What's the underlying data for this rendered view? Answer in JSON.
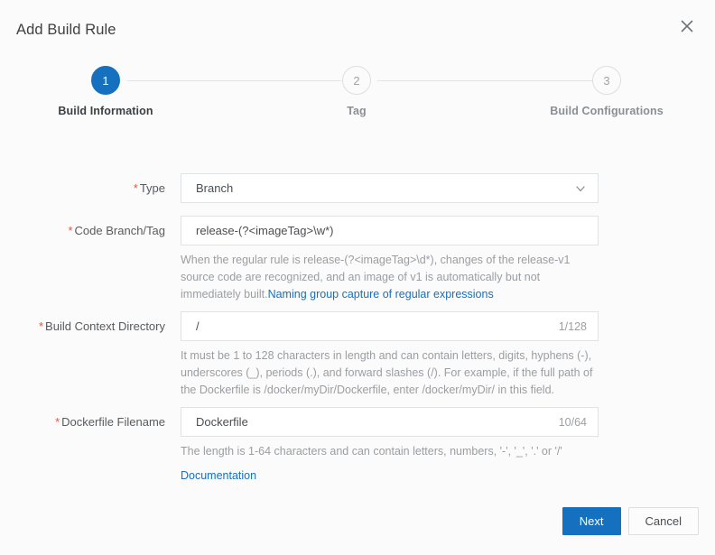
{
  "dialog": {
    "title": "Add Build Rule",
    "close_icon": "close-icon"
  },
  "stepper": {
    "steps": [
      {
        "number": "1",
        "label": "Build Information",
        "state": "active"
      },
      {
        "number": "2",
        "label": "Tag",
        "state": "inactive"
      },
      {
        "number": "3",
        "label": "Build Configurations",
        "state": "inactive"
      }
    ]
  },
  "form": {
    "type": {
      "label": "Type",
      "required_marker": "*",
      "value": "Branch",
      "chevron_icon": "chevron-down-icon"
    },
    "code_branch_tag": {
      "label": "Code Branch/Tag",
      "required_marker": "*",
      "value": "release-(?<imageTag>\\w*)",
      "hint_text": "When the regular rule is release-(?<imageTag>\\d*), changes of the release-v1 source code are recognized, and an image of v1 is automatically but not immediately built.",
      "hint_link": "Naming group capture of regular expressions"
    },
    "build_context_directory": {
      "label": "Build Context Directory",
      "required_marker": "*",
      "value": "/",
      "counter": "1/128",
      "hint_text": "It must be 1 to 128 characters in length and can contain letters, digits, hyphens (-), underscores (_), periods (.), and forward slashes (/). For example, if the full path of the Dockerfile is /docker/myDir/Dockerfile, enter /docker/myDir/ in this field."
    },
    "dockerfile_filename": {
      "label": "Dockerfile Filename",
      "required_marker": "*",
      "value": "Dockerfile",
      "counter": "10/64",
      "hint_text": "The length is 1-64 characters and can contain letters, numbers, '-', '_', '.' or '/'",
      "doc_link": "Documentation"
    }
  },
  "footer": {
    "next_label": "Next",
    "cancel_label": "Cancel"
  },
  "colors": {
    "accent": "#1570c0",
    "required": "#e8543f",
    "link": "#1570c0",
    "background": "#fbfbfb",
    "border": "#e0e3e6"
  }
}
